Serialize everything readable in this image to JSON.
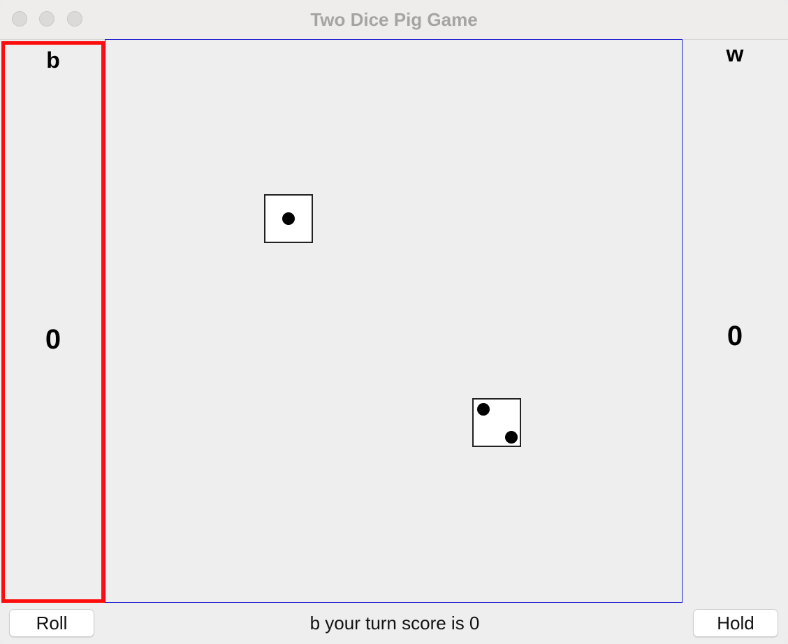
{
  "window": {
    "title": "Two Dice Pig Game"
  },
  "players": {
    "left": {
      "name": "b",
      "score": "0",
      "active": true
    },
    "right": {
      "name": "w",
      "score": "0",
      "active": false
    }
  },
  "dice": [
    {
      "value": 1
    },
    {
      "value": 2
    }
  ],
  "controls": {
    "roll_label": "Roll",
    "hold_label": "Hold"
  },
  "status": {
    "message": "b your turn score is 0"
  },
  "colors": {
    "active_player_border": "#ff0d0d",
    "board_border": "#1c1ccf"
  }
}
